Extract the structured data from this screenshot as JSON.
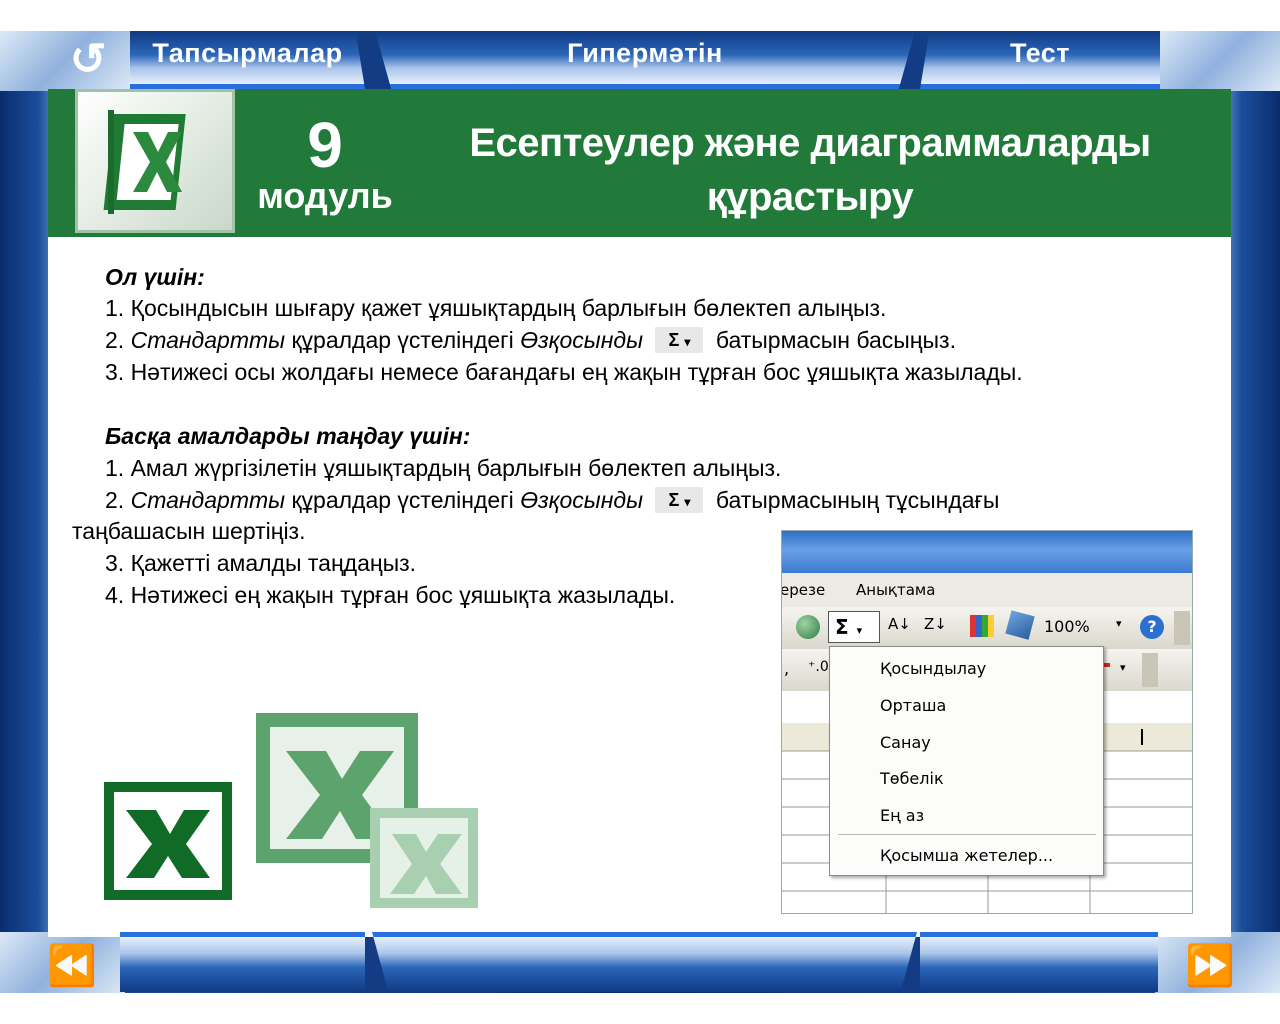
{
  "nav": {
    "tasks": "Тапсырмалар",
    "hypertext": "Гипермәтін",
    "test": "Тест"
  },
  "header": {
    "module_number": "9",
    "module_word": "модуль",
    "title_line1": "Есептеулер және диаграммаларды",
    "title_line2": "құрастыру"
  },
  "section1": {
    "heading": "Ол үшін:",
    "step1": "1. Қосындысын шығару қажет ұяшықтардың барлығын бөлектеп алыңыз.",
    "step2_num": "2.",
    "step2_italic1": "Стандартты",
    "step2_text1": "құралдар үстеліндегі",
    "step2_italic2": "Өзқосынды",
    "step2_text2": "батырмасын басыңыз.",
    "step3": "3. Нәтижесі осы жолдағы немесе бағандағы ең жақын тұрған бос ұяшықта жазылады."
  },
  "section2": {
    "heading": "Басқа амалдарды таңдау үшін:",
    "step1": "1. Амал жүргізілетін ұяшықтардың барлығын бөлектеп алыңыз.",
    "step2_num": "2.",
    "step2_italic1": "Стандартты",
    "step2_text1": "құралдар үстеліндегі",
    "step2_italic2": "Өзқосынды",
    "step2_text2": "батырмасының тұсындағы",
    "step2_cont": "таңбашасын шертіңіз.",
    "step3": "3. Қажетті амалды таңдаңыз.",
    "step4": "4. Нәтижесі ең жақын тұрған бос ұяшықта жазылады."
  },
  "autosum_symbol": "Σ",
  "autosum_arrow": "▾",
  "excel": {
    "menu_window": "ерезе",
    "menu_help": "Анықтама",
    "zoom": "100%",
    "dropdown": [
      "Қосындылау",
      "Орташа",
      "Санау",
      "Төбелік",
      "Ең аз",
      "Қосымша жетелер..."
    ]
  },
  "colors": {
    "header_green": "#217a3a",
    "frame_blue": "#0b2c6e",
    "accent_blue": "#2a6fe0"
  }
}
